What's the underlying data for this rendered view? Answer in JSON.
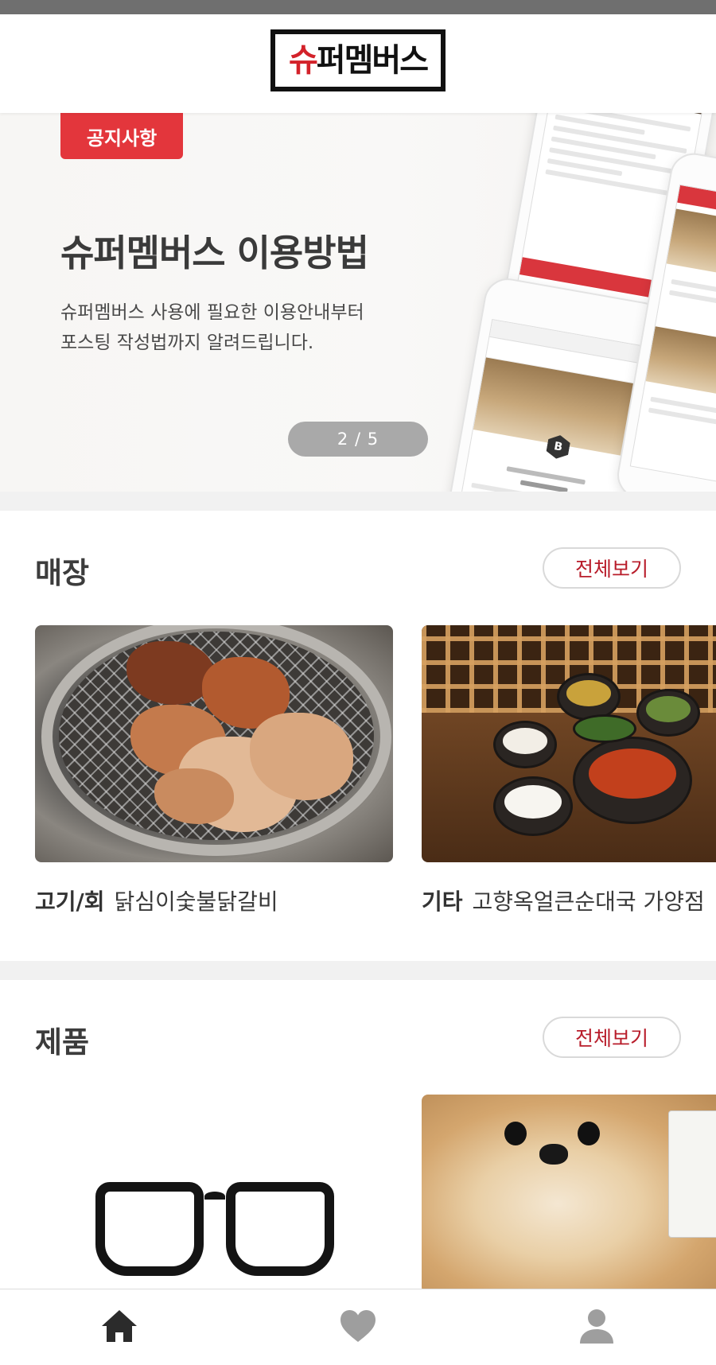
{
  "header": {
    "logo_text_red": "슈",
    "logo_text_black": "퍼멤버스"
  },
  "banner": {
    "badge": "공지사항",
    "title": "슈퍼멤버스 이용방법",
    "desc_line1": "슈퍼멤버스 사용에 필요한 이용안내부터",
    "desc_line2": "포스팅 작성법까지 알려드립니다.",
    "page_indicator": "2 / 5",
    "current_page": 2,
    "total_pages": 5
  },
  "stores": {
    "title": "매장",
    "view_all": "전체보기",
    "items": [
      {
        "category": "고기/회",
        "name": "닭심이숯불닭갈비"
      },
      {
        "category": "기타",
        "name": "고향옥얼큰순대국 가양점"
      }
    ]
  },
  "products": {
    "title": "제품",
    "view_all": "전체보기"
  },
  "bottom_nav": {
    "items": [
      {
        "icon": "home-icon",
        "active": true
      },
      {
        "icon": "heart-icon",
        "active": false
      },
      {
        "icon": "user-icon",
        "active": false
      }
    ]
  },
  "colors": {
    "brand_red": "#e3363c",
    "view_all_text": "#b81c2a",
    "nav_active": "#2b2b2b",
    "nav_inactive": "#9e9e9e"
  }
}
